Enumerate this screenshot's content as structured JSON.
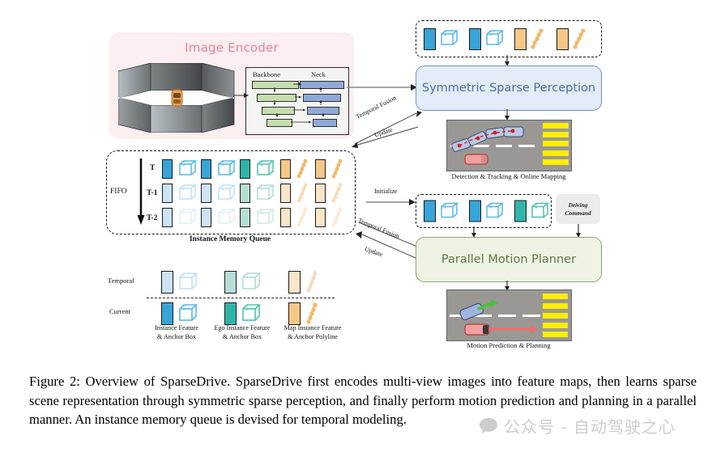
{
  "figure": {
    "encoder": {
      "title": "Image Encoder",
      "backbone_label": "Backbone",
      "neck_label": "Neck",
      "backbone_color": "#c6ddaf",
      "neck_color": "#8fa9d8",
      "panel_color": "#fdeef0",
      "title_color": "#e08596"
    },
    "perception": {
      "label": "Symmetric Sparse Perception",
      "box_color": "#e3ecf9",
      "border_color": "#7296c9",
      "text_color": "#4a6fa5"
    },
    "planner": {
      "label": "Parallel Motion Planner",
      "box_color": "#eef3e4",
      "border_color": "#8ca86a",
      "text_color": "#5d7a41"
    },
    "driving_command": {
      "line1": "Driving",
      "line2": "Command"
    },
    "scenes": [
      {
        "caption": "Detection & Tracking & Online Mapping"
      },
      {
        "caption": "Motion Prediction & Planning"
      }
    ],
    "memory_queue": {
      "caption": "Instance Memory Queue",
      "fifo_label": "FIFO",
      "row_labels": [
        "T",
        "T-1",
        "T-2"
      ]
    },
    "legend": {
      "row_labels": [
        "Temporal",
        "Current"
      ],
      "items": [
        {
          "line1": "Instance Feature",
          "line2": "& Anchor Box",
          "color": "#38a4d8"
        },
        {
          "line1": "Ego Instance Feature",
          "line2": "& Anchor Box",
          "color": "#2fb5a8"
        },
        {
          "line1": "Map Instance Feature",
          "line2": "& Anchor Polyline",
          "color": "#f6c887"
        }
      ]
    },
    "arrow_labels": {
      "temporal_fusion_top": "Temporal Fusion",
      "update_top": "Update",
      "initialize": "Initialize",
      "temporal_fusion_mid": "Temporal Fusion",
      "update_mid": "Update"
    }
  },
  "caption": {
    "text": "Figure 2: Overview of SparseDrive. SparseDrive first encodes multi-view images into feature maps, then learns sparse scene representation through symmetric sparse perception, and finally perform motion prediction and planning in a parallel manner.  An instance memory queue is devised for temporal modeling."
  },
  "watermark": {
    "text": "公众号 - 自动驾驶之心"
  }
}
